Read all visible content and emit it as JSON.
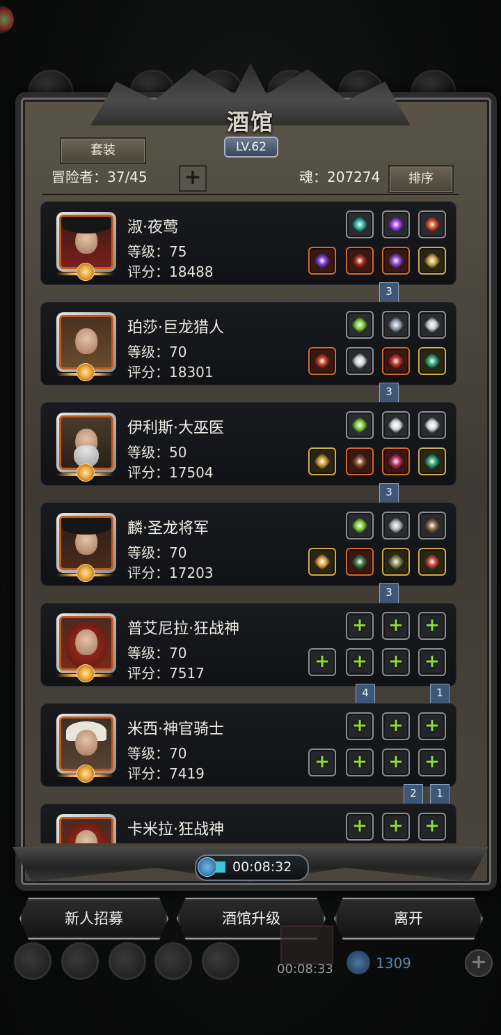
{
  "header": {
    "title": "酒馆",
    "level": "LV.62",
    "suit_button": "套装",
    "adventurers_label": "冒险者：37/45",
    "add_button": "+",
    "soul_label": "魂：207274",
    "sort_button": "排序"
  },
  "heroes": [
    {
      "name": "淑·夜莺",
      "level": "等级：75",
      "score": "评分：18488",
      "portrait": "dark-hat-female",
      "top_slots": [
        {
          "type": "gray",
          "icon": "teal-orb-icon"
        },
        {
          "type": "gray",
          "icon": "purple-crystal-icon"
        },
        {
          "type": "gray",
          "icon": "red-sigil-icon"
        }
      ],
      "bottom_slots": [
        {
          "type": "orange",
          "icon": "purple-blade-icon"
        },
        {
          "type": "orange",
          "icon": "red-armor-icon"
        },
        {
          "type": "orange",
          "icon": "purple-mask-icon"
        },
        {
          "type": "gold",
          "icon": "amulet-icon"
        }
      ],
      "flags": [
        {
          "value": "3"
        }
      ]
    },
    {
      "name": "珀莎·巨龙猎人",
      "level": "等级：70",
      "score": "评分：18301",
      "portrait": "headband-female",
      "top_slots": [
        {
          "type": "gray",
          "icon": "green-drill-icon"
        },
        {
          "type": "gray",
          "icon": "lightning-stone-icon"
        },
        {
          "type": "gray",
          "icon": "silver-amulet-icon"
        }
      ],
      "bottom_slots": [
        {
          "type": "orange",
          "icon": "crossed-blades-icon"
        },
        {
          "type": "gray",
          "icon": "white-armor-icon"
        },
        {
          "type": "orange",
          "icon": "red-orb-icon"
        },
        {
          "type": "gold",
          "icon": "green-ring-icon"
        }
      ],
      "flags": [
        {
          "value": "3"
        }
      ]
    },
    {
      "name": "伊利斯·大巫医",
      "level": "等级：50",
      "score": "评分：17504",
      "portrait": "bearded-elder",
      "top_slots": [
        {
          "type": "gray",
          "icon": "green-drill-icon"
        },
        {
          "type": "gray",
          "icon": "feather-blade-icon"
        },
        {
          "type": "gray",
          "icon": "feather-blade-icon"
        }
      ],
      "bottom_slots": [
        {
          "type": "gold",
          "icon": "staff-icon"
        },
        {
          "type": "orange",
          "icon": "brown-armor-icon"
        },
        {
          "type": "orange",
          "icon": "red-mask-icon"
        },
        {
          "type": "gold",
          "icon": "green-ring-icon"
        }
      ],
      "flags": [
        {
          "value": "3"
        }
      ]
    },
    {
      "name": "麟·圣龙将军",
      "level": "等级：70",
      "score": "评分：17203",
      "portrait": "dark-hat-male",
      "top_slots": [
        {
          "type": "gray",
          "icon": "green-drill-icon"
        },
        {
          "type": "gray",
          "icon": "winged-crest-icon"
        },
        {
          "type": "gray",
          "icon": "bow-icon"
        }
      ],
      "bottom_slots": [
        {
          "type": "gold",
          "icon": "golden-claw-icon"
        },
        {
          "type": "orange",
          "icon": "green-armor-icon"
        },
        {
          "type": "gold",
          "icon": "shield-icon"
        },
        {
          "type": "gold",
          "icon": "heart-amulet-icon"
        }
      ],
      "flags": [
        {
          "value": "3"
        }
      ]
    },
    {
      "name": "普艾尼拉·狂战神",
      "level": "等级：70",
      "score": "评分：7517",
      "portrait": "red-hair-female",
      "top_slots": [
        {
          "type": "empty",
          "icon": "plus-icon"
        },
        {
          "type": "empty",
          "icon": "plus-icon"
        },
        {
          "type": "empty",
          "icon": "plus-icon"
        }
      ],
      "bottom_slots": [
        {
          "type": "empty",
          "icon": "plus-icon"
        },
        {
          "type": "empty",
          "icon": "plus-icon"
        },
        {
          "type": "empty",
          "icon": "plus-icon"
        },
        {
          "type": "empty",
          "icon": "plus-icon"
        }
      ],
      "flags": [
        {
          "value": "4"
        },
        {
          "value": "1"
        }
      ]
    },
    {
      "name": "米西·神官骑士",
      "level": "等级：70",
      "score": "评分：7419",
      "portrait": "hooded-female",
      "top_slots": [
        {
          "type": "empty",
          "icon": "plus-icon"
        },
        {
          "type": "empty",
          "icon": "plus-icon"
        },
        {
          "type": "empty",
          "icon": "plus-icon"
        }
      ],
      "bottom_slots": [
        {
          "type": "empty",
          "icon": "plus-icon"
        },
        {
          "type": "empty",
          "icon": "plus-icon"
        },
        {
          "type": "empty",
          "icon": "plus-icon"
        },
        {
          "type": "empty",
          "icon": "plus-icon"
        }
      ],
      "flags": [
        {
          "value": "2"
        },
        {
          "value": "1"
        }
      ]
    },
    {
      "name": "卡米拉·狂战神",
      "level": "",
      "score": "",
      "portrait": "red-hair-female",
      "top_slots": [
        {
          "type": "empty",
          "icon": "plus-icon"
        },
        {
          "type": "empty",
          "icon": "plus-icon"
        },
        {
          "type": "empty",
          "icon": "plus-icon"
        }
      ],
      "bottom_slots": [],
      "flags": []
    }
  ],
  "timer": {
    "time": "00:08:32"
  },
  "buttons": {
    "recruit": "新人招募",
    "upgrade": "酒馆升级",
    "leave": "离开"
  },
  "background": {
    "time": "00:08:33",
    "count": "1309"
  }
}
